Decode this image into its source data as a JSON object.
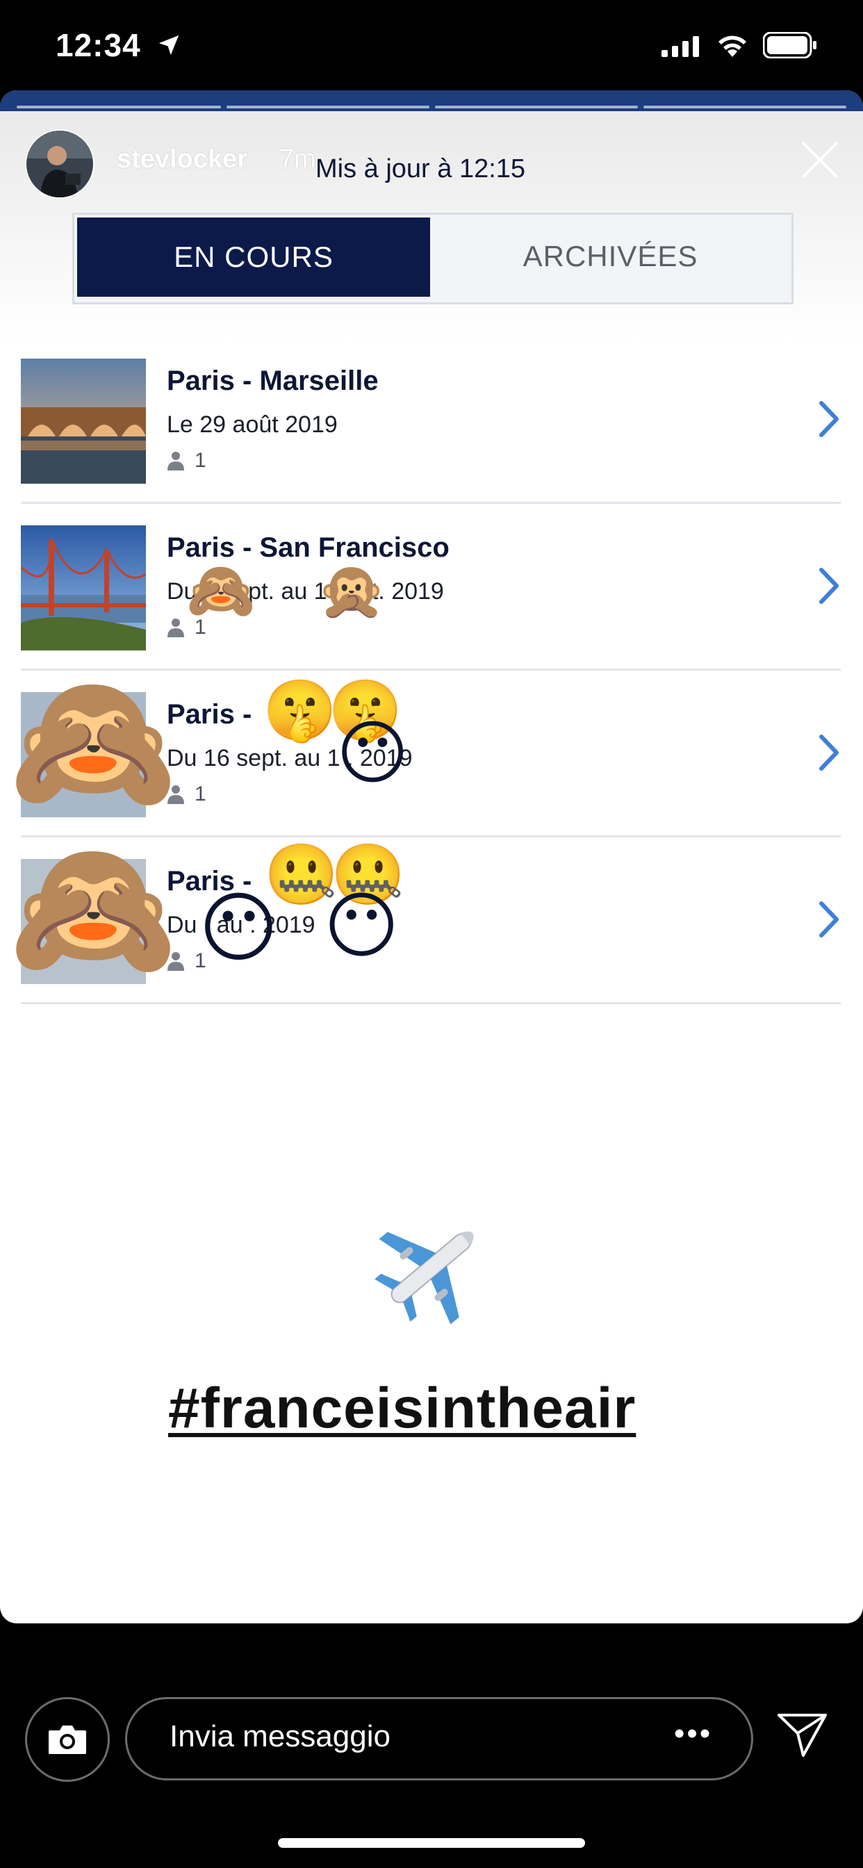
{
  "status_bar": {
    "time": "12:34"
  },
  "story": {
    "username": "stevlocker",
    "time_ago": "7m",
    "updated_label": "Mis à jour à 12:15",
    "tabs": [
      {
        "label": "EN COURS",
        "active": true
      },
      {
        "label": "ARCHIVÉES",
        "active": false
      }
    ],
    "trips": [
      {
        "title": "Paris - Marseille",
        "dates": "Le 29 août 2019",
        "passengers": "1"
      },
      {
        "title": "Paris - San Francisco",
        "dates": "Du 1 sept. au 1 sept. 2019",
        "passengers": "1"
      },
      {
        "title": "Paris - ",
        "dates": "Du 16 sept. au 1 . 2019",
        "passengers": "1"
      },
      {
        "title": "Paris - ",
        "dates": "Du . au . 2019",
        "passengers": "1"
      }
    ],
    "stickers": {
      "plane": "✈️",
      "hashtag": "#franceisintheair",
      "see_no_evil": "🙈",
      "speak_no_evil": "🙊",
      "shushing": "🤫",
      "no_mouth": "😶",
      "zipper_mouth": "🤐"
    }
  },
  "bottom_bar": {
    "message_placeholder": "Invia messaggio",
    "more": "•••"
  },
  "colors": {
    "tab_active": "#0c1a4a",
    "chevron": "#3f7fd9",
    "header_strip": "#1d3d7d"
  }
}
